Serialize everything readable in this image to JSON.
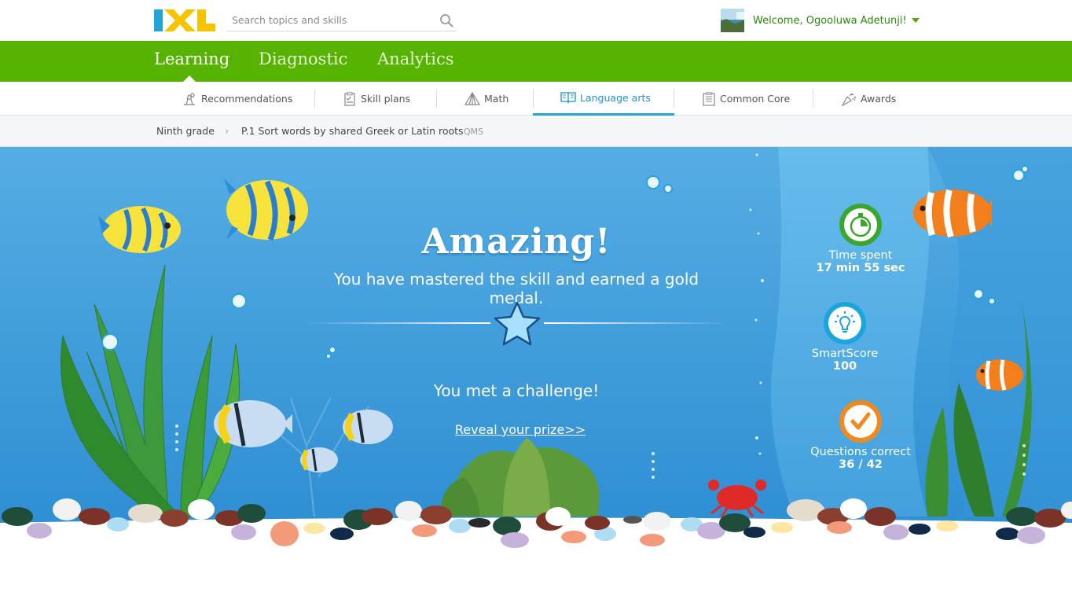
{
  "header": {
    "search_placeholder": "Search topics and skills",
    "welcome": "Welcome, Ogooluwa Adetunji!"
  },
  "main_nav": {
    "tabs": [
      {
        "label": "Learning",
        "active": true
      },
      {
        "label": "Diagnostic",
        "active": false
      },
      {
        "label": "Analytics",
        "active": false
      }
    ]
  },
  "sub_nav": {
    "items": [
      {
        "label": "Recommendations",
        "icon": "recommendations-icon"
      },
      {
        "label": "Skill plans",
        "icon": "skill-plans-icon"
      },
      {
        "label": "Math",
        "icon": "math-icon"
      },
      {
        "label": "Language arts",
        "icon": "language-arts-icon",
        "active": true
      },
      {
        "label": "Common Core",
        "icon": "common-core-icon"
      },
      {
        "label": "Awards",
        "icon": "awards-icon"
      }
    ]
  },
  "breadcrumb": {
    "grade": "Ninth grade",
    "skill": "P.1 Sort words by shared Greek or Latin roots",
    "code": "QMS"
  },
  "result": {
    "headline": "Amazing!",
    "message": "You have mastered the skill and earned a gold medal.",
    "challenge": "You met a challenge!",
    "reveal": "Reveal your prize>>"
  },
  "stats": {
    "time_label": "Time spent",
    "time_value": "17 min 55 sec",
    "smartscore_label": "SmartScore",
    "smartscore_value": "100",
    "questions_label": "Questions correct",
    "questions_value": "36 / 42"
  },
  "colors": {
    "brand_green": "#56b300",
    "accent_blue": "#21a5d7",
    "water": "#3d9ede"
  }
}
